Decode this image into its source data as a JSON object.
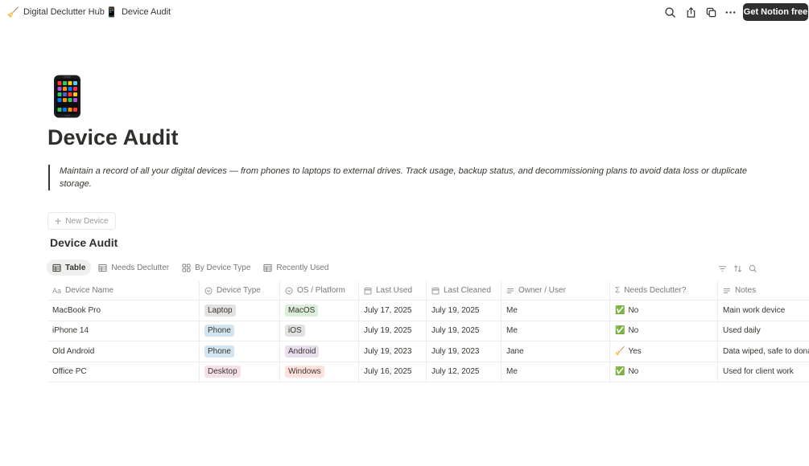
{
  "topbar": {
    "crumbs": [
      {
        "emoji": "🧹",
        "label": "Digital Declutter Hub"
      },
      {
        "emoji": "📱",
        "label": "Device Audit"
      }
    ],
    "separator": "/",
    "icons": [
      "search-icon",
      "share-icon",
      "duplicate-icon",
      "more-icon"
    ],
    "cta_label": "Get Notion free"
  },
  "page": {
    "icon": "phone-icon",
    "title": "Device Audit",
    "description": "Maintain a record of all your digital devices — from phones to laptops to external drives. Track usage, backup status, and decommissioning plans to avoid data loss or duplicate storage.",
    "new_button": "New Device",
    "db_title": "Device Audit"
  },
  "views": [
    {
      "label": "Table",
      "icon": "table-icon",
      "active": true
    },
    {
      "label": "Needs Declutter",
      "icon": "table-icon",
      "active": false
    },
    {
      "label": "By Device Type",
      "icon": "board-icon",
      "active": false
    },
    {
      "label": "Recently Used",
      "icon": "table-icon",
      "active": false
    }
  ],
  "view_tools": [
    "filter-icon",
    "sort-icon",
    "search-icon"
  ],
  "table": {
    "columns": [
      {
        "label": "Device Name",
        "icon": "title-icon"
      },
      {
        "label": "Device Type",
        "icon": "select-icon"
      },
      {
        "label": "OS / Platform",
        "icon": "select-icon"
      },
      {
        "label": "Last Used",
        "icon": "calendar-icon"
      },
      {
        "label": "Last Cleaned",
        "icon": "calendar-icon"
      },
      {
        "label": "Owner / User",
        "icon": "text-icon"
      },
      {
        "label": "Needs Declutter?",
        "icon": "formula-icon"
      },
      {
        "label": "Notes",
        "icon": "text-icon"
      }
    ],
    "rows": [
      {
        "name": "MacBook Pro",
        "type": "Laptop",
        "os": "MacOS",
        "last_used": "July 17, 2025",
        "last_cleaned": "July 19, 2025",
        "owner": "Me",
        "declutter_emoji": "✅",
        "declutter": "No",
        "notes": "Main work device"
      },
      {
        "name": "iPhone 14",
        "type": "Phone",
        "os": "iOS",
        "last_used": "July 19, 2025",
        "last_cleaned": "July 19, 2025",
        "owner": "Me",
        "declutter_emoji": "✅",
        "declutter": "No",
        "notes": "Used daily"
      },
      {
        "name": "Old Android",
        "type": "Phone",
        "os": "Android",
        "last_used": "July 19, 2023",
        "last_cleaned": "July 19, 2023",
        "owner": "Jane",
        "declutter_emoji": "🧹",
        "declutter": "Yes",
        "notes": "Data wiped, safe to dona"
      },
      {
        "name": "Office PC",
        "type": "Desktop",
        "os": "Windows",
        "last_used": "July 16, 2025",
        "last_cleaned": "July 12, 2025",
        "owner": "Me",
        "declutter_emoji": "✅",
        "declutter": "No",
        "notes": "Used for client work"
      }
    ]
  },
  "tag_colors": {
    "Laptop": "#e3e2e0",
    "Phone": "#d3e5ef",
    "Desktop": "#f5e0e9",
    "MacOS": "#dbeddb",
    "iOS": "#e3e2e0",
    "Android": "#e8deee",
    "Windows": "#ffe2dd"
  }
}
